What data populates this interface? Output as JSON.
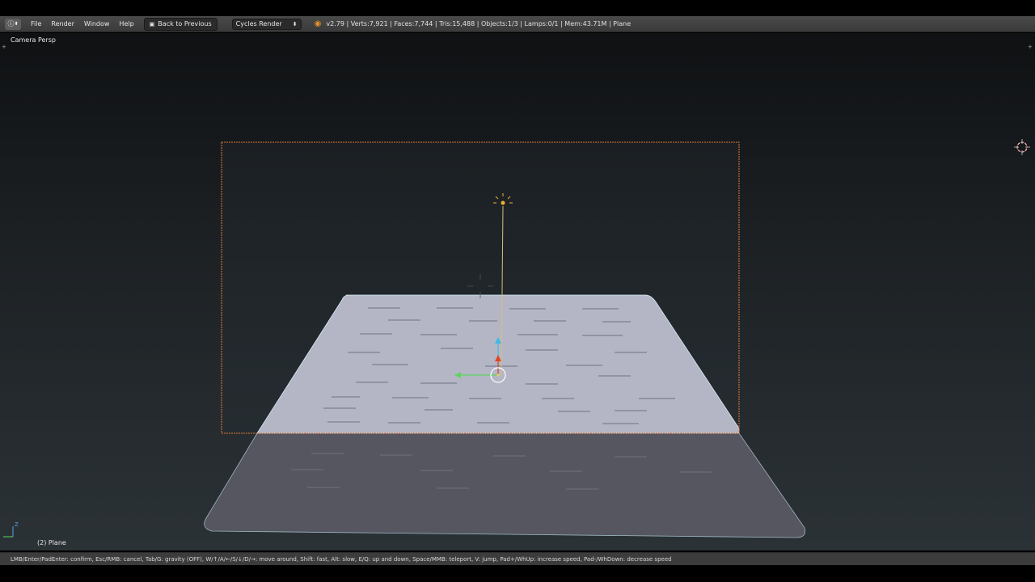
{
  "header": {
    "editor_type_icon": "info-icon",
    "menus": [
      "File",
      "Render",
      "Window",
      "Help"
    ],
    "back_button": {
      "label": "Back to Previous",
      "icon": "screen-icon"
    },
    "render_engine": "Cycles Render",
    "logo_icon": "blender-logo-icon",
    "stats": "v2.79 | Verts:7,921 | Faces:7,744 | Tris:15,488 | Objects:1/3 | Lamps:0/1 | Mem:43.71M | Plane"
  },
  "viewport": {
    "view_label": "Camera Persp",
    "object_label": "(2) Plane",
    "axis_label": "Z"
  },
  "status_bar": {
    "text": "LMB/Enter/PadEnter: confirm, Esc/RMB: cancel, Tab/G: gravity (OFF), W/↑/A/←/S/↓/D/→: move around, Shift: fast, Alt: slow, E/Q: up and down, Space/MMB: teleport, V: jump, Pad+/WhUp: increase speed, Pad-/WhDown: decrease speed"
  },
  "colors": {
    "camera_frame": "#e07b39",
    "plane_lit": "#b4b6c6",
    "plane_shadow": "#55565f",
    "lamp": "#f0b030",
    "y_axis_arrow": "#5fd35f",
    "z_axis_arrow": "#3fb8e8",
    "x_axis_arrow": "#e0452a"
  }
}
